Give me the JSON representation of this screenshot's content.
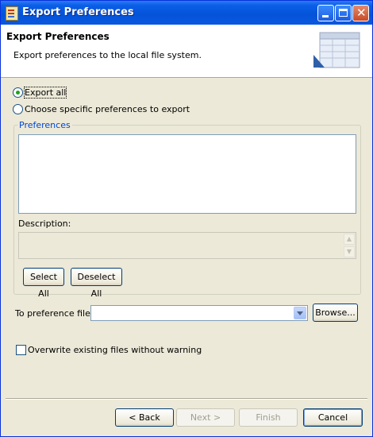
{
  "window": {
    "title": "Export Preferences"
  },
  "banner": {
    "title": "Export Preferences",
    "description": "Export preferences to the local file system."
  },
  "options": {
    "export_all": "Export all",
    "choose_specific": "Choose specific preferences to export",
    "selected": "export_all"
  },
  "group": {
    "title": "Preferences",
    "description_label": "Description:",
    "select_all": "Select All",
    "deselect_all": "Deselect All"
  },
  "file": {
    "label": "To preference file:",
    "value": "",
    "browse": "Browse..."
  },
  "overwrite": {
    "label": "Overwrite existing files without warning",
    "checked": false
  },
  "buttons": {
    "back": "< Back",
    "next": "Next >",
    "finish": "Finish",
    "cancel": "Cancel"
  },
  "colors": {
    "titlebar": "#0453d8",
    "group_title": "#0046d5",
    "radio_dot": "#21a121",
    "dialog_bg": "#ece9d8"
  },
  "icons": {
    "app": "export-wizard-icon",
    "minimize": "minimize-icon",
    "maximize": "maximize-icon",
    "close": "close-icon",
    "banner": "wizard-banner-icon"
  }
}
